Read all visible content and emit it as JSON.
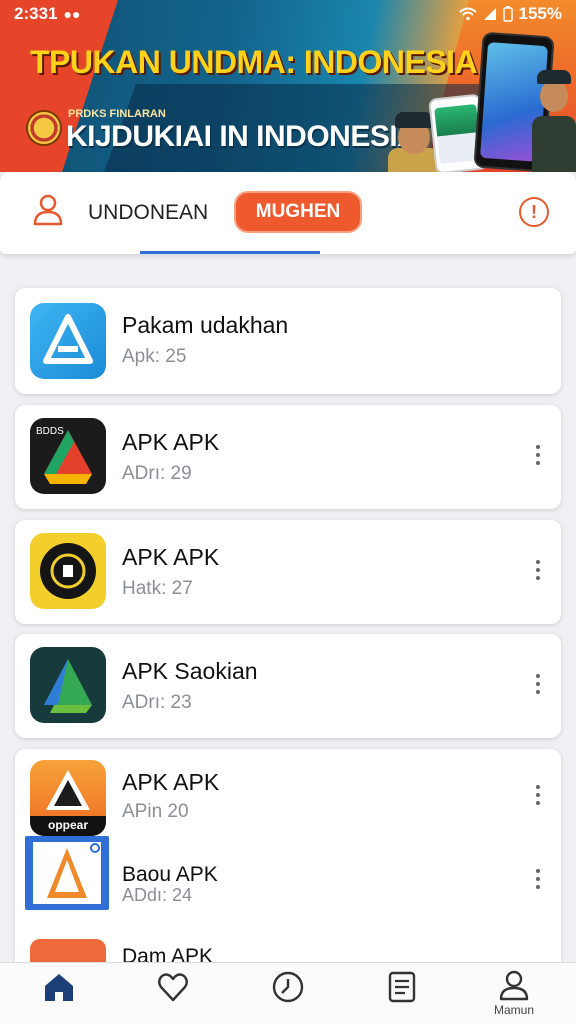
{
  "status_bar": {
    "time": "2:331",
    "battery": "155%"
  },
  "banner": {
    "headline": "TPUKAN UNDMA: INDONESIA",
    "sub_small": "PRDKS FINLARAN",
    "subheadline": "KIJDUKIAI IN INDONESIA"
  },
  "tabs": {
    "label": "UNDONEAN",
    "active_pill": "MUGHEN",
    "info_glyph": "!"
  },
  "apps": [
    {
      "title": "Pakam udakhan",
      "subtitle": "Apk: 25",
      "icon": "blue-a-logo-icon"
    },
    {
      "title": "APK APK",
      "subtitle": "ADrı: 29",
      "icon": "drive-triangle-icon"
    },
    {
      "title": "APK APK",
      "subtitle": "Hatk: 27",
      "icon": "gold-badge-icon"
    },
    {
      "title": "APK Saokian",
      "subtitle": "ADrı: 23",
      "icon": "green-play-triangle-icon"
    },
    {
      "title": "APK APK",
      "subtitle": "APin 20",
      "icon": "orange-triangle-icon",
      "icon_caption": "oppear"
    },
    {
      "title": "Baou APK",
      "subtitle": "ADdı: 24",
      "icon": "blue-a-triangle-icon"
    },
    {
      "title": "Dam APK",
      "subtitle": "",
      "icon": "partial-orange-icon"
    }
  ],
  "bottom_nav": {
    "items": [
      {
        "icon": "home-icon",
        "label": ""
      },
      {
        "icon": "heart-icon",
        "label": ""
      },
      {
        "icon": "clock-icon",
        "label": ""
      },
      {
        "icon": "document-icon",
        "label": ""
      },
      {
        "icon": "person-icon",
        "label": "Mamun"
      }
    ]
  }
}
